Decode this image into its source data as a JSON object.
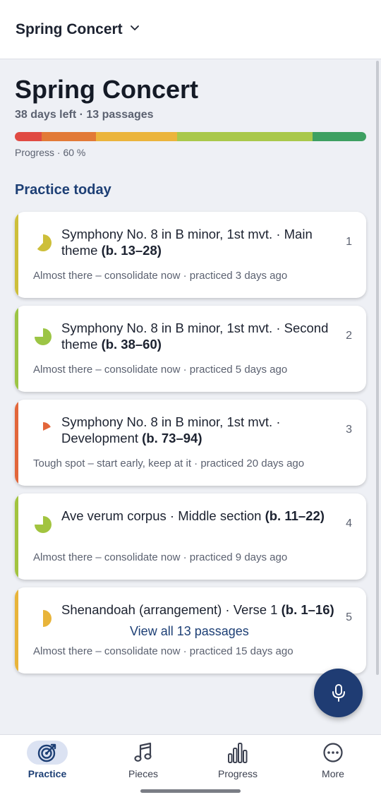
{
  "header": {
    "concert_name": "Spring Concert"
  },
  "summary": {
    "title": "Spring Concert",
    "subtitle": "38 days left · 13 passages",
    "progress_label": "Progress · 60 %",
    "progress_percent": 60,
    "progress_segments": [
      {
        "color": "#e04a43",
        "fraction": 0.077
      },
      {
        "color": "#e27a37",
        "fraction": 0.154
      },
      {
        "color": "#ebb43c",
        "fraction": 0.231
      },
      {
        "color": "#a9c84a",
        "fraction": 0.385
      },
      {
        "color": "#3ea062",
        "fraction": 0.153
      }
    ]
  },
  "practice_today": {
    "heading": "Practice today",
    "items": [
      {
        "rank": "1",
        "title": "Symphony No. 8 in B minor, 1st mvt. · Main theme ",
        "bars": "(b. 13–28)",
        "status": "Almost there – consolidate now · practiced 3 days ago",
        "color": "#cdbf3a",
        "fill_fraction": 0.62
      },
      {
        "rank": "2",
        "title": "Symphony No. 8 in B minor, 1st mvt. · Second theme ",
        "bars": "(b. 38–60)",
        "status": "Almost there – consolidate now · practiced 5 days ago",
        "color": "#9cc545",
        "fill_fraction": 0.75
      },
      {
        "rank": "3",
        "title": "Symphony No. 8 in B minor, 1st mvt. · Development ",
        "bars": "(b. 73–94)",
        "status": "Tough spot – start early, keep at it · practiced 20 days ago",
        "color": "#e2663a",
        "fill_fraction": 0.18
      },
      {
        "rank": "4",
        "title": "Ave verum corpus · Middle section ",
        "bars": "(b. 11–22)",
        "status": "Almost there – consolidate now · practiced 9 days ago",
        "color": "#a2c43f",
        "fill_fraction": 0.75
      },
      {
        "rank": "5",
        "title": "Shenandoah (arrangement) · Verse 1 ",
        "bars": "(b. 1–16)",
        "status": "Almost there – consolidate now · practiced 15 days ago",
        "color": "#e8b43a",
        "fill_fraction": 0.5
      }
    ],
    "view_all_label": "View all 13 passages"
  },
  "fab": {
    "icon": "microphone-icon"
  },
  "bottom_nav": [
    {
      "label": "Practice",
      "icon": "target-icon",
      "active": true
    },
    {
      "label": "Pieces",
      "icon": "music-note-icon",
      "active": false
    },
    {
      "label": "Progress",
      "icon": "bar-chart-icon",
      "active": false
    },
    {
      "label": "More",
      "icon": "more-icon",
      "active": false
    }
  ]
}
